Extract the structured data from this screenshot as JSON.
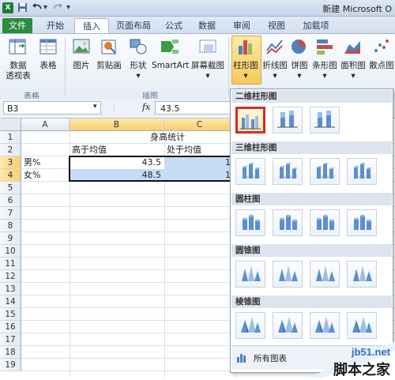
{
  "window": {
    "title": "新建 Microsoft O"
  },
  "quick_access": {
    "save_icon": "save-icon",
    "undo_icon": "undo-icon",
    "redo_icon": "redo-icon"
  },
  "tabs": [
    "文件",
    "开始",
    "插入",
    "页面布局",
    "公式",
    "数据",
    "审阅",
    "视图",
    "加载项"
  ],
  "ribbon": {
    "pivot_label_1": "数据",
    "pivot_label_2": "透视表",
    "table_label": "表格",
    "picture_label": "图片",
    "clipart_label": "剪贴画",
    "shapes_label": "形状",
    "smartart_label": "SmartArt",
    "screenshot_label": "屏幕截图",
    "column_label": "柱形图",
    "line_label": "折线图",
    "pie_label": "饼图",
    "bar_label": "条形图",
    "area_label": "面积图",
    "scatter_label": "散点图",
    "group_tables": "表格",
    "group_illustrations": "插图"
  },
  "formula_bar": {
    "name_box": "B3",
    "fx": "fx",
    "value": "43.5"
  },
  "sheet": {
    "columns": [
      "A",
      "B",
      "C"
    ],
    "rows": [
      "1",
      "2",
      "3",
      "4",
      "5",
      "6",
      "7",
      "8",
      "9",
      "10",
      "11",
      "12",
      "13",
      "14",
      "15",
      "16",
      "17",
      "18",
      "19"
    ],
    "title": "身高统计",
    "header_b": "高于均值",
    "header_c": "处于均值",
    "a3": "男%",
    "a4": "女%",
    "b3": "43.5",
    "b4": "48.5",
    "c3": "1",
    "c4": "1"
  },
  "gallery": {
    "section_2d_column": "二维柱形图",
    "section_3d_column": "三维柱形图",
    "section_cylinder": "圆柱图",
    "section_cone": "圆锥图",
    "section_pyramid": "棱锥图",
    "all_charts": "所有图表"
  },
  "watermark": {
    "site": "jb51.net",
    "name": "脚本之家"
  },
  "colors": {
    "selection_fill": "#c6dcf5",
    "highlight": "#d42b2b",
    "file_tab": "#2c8b3c"
  }
}
